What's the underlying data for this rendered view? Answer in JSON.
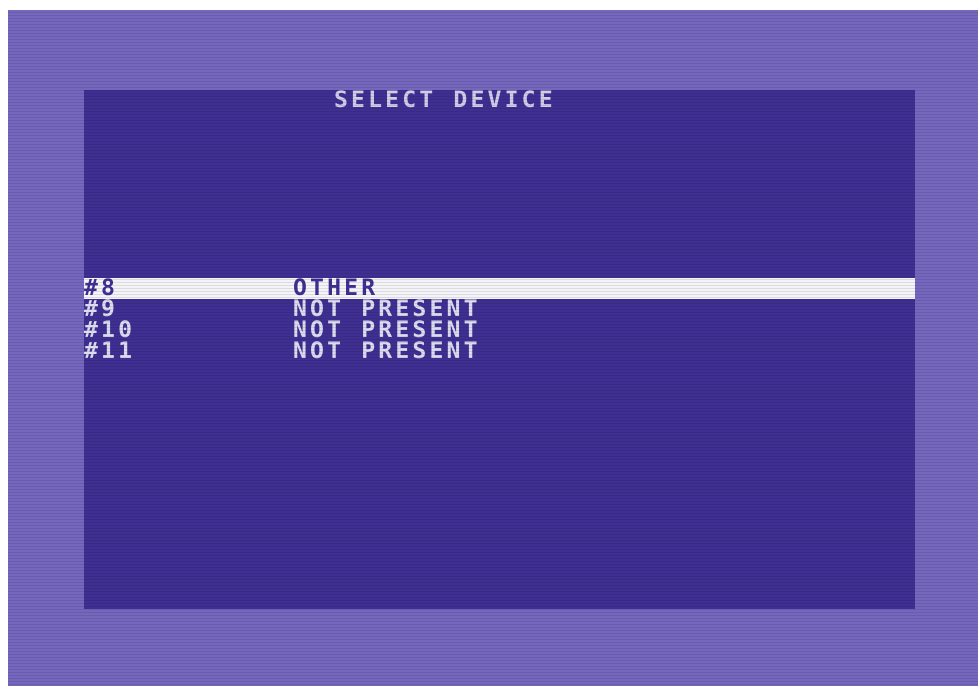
{
  "screen": {
    "title": "SELECT DEVICE",
    "devices": [
      {
        "number": "#8",
        "status": "OTHER",
        "selected": true
      },
      {
        "number": "#9",
        "status": "NOT PRESENT",
        "selected": false
      },
      {
        "number": "#10",
        "status": "NOT PRESENT",
        "selected": false
      },
      {
        "number": "#11",
        "status": "NOT PRESENT",
        "selected": false
      }
    ]
  },
  "colors": {
    "border": "#7567bd",
    "background": "#3f2f92",
    "text": "#dcdcf0",
    "highlight": "#f4f4f8"
  }
}
